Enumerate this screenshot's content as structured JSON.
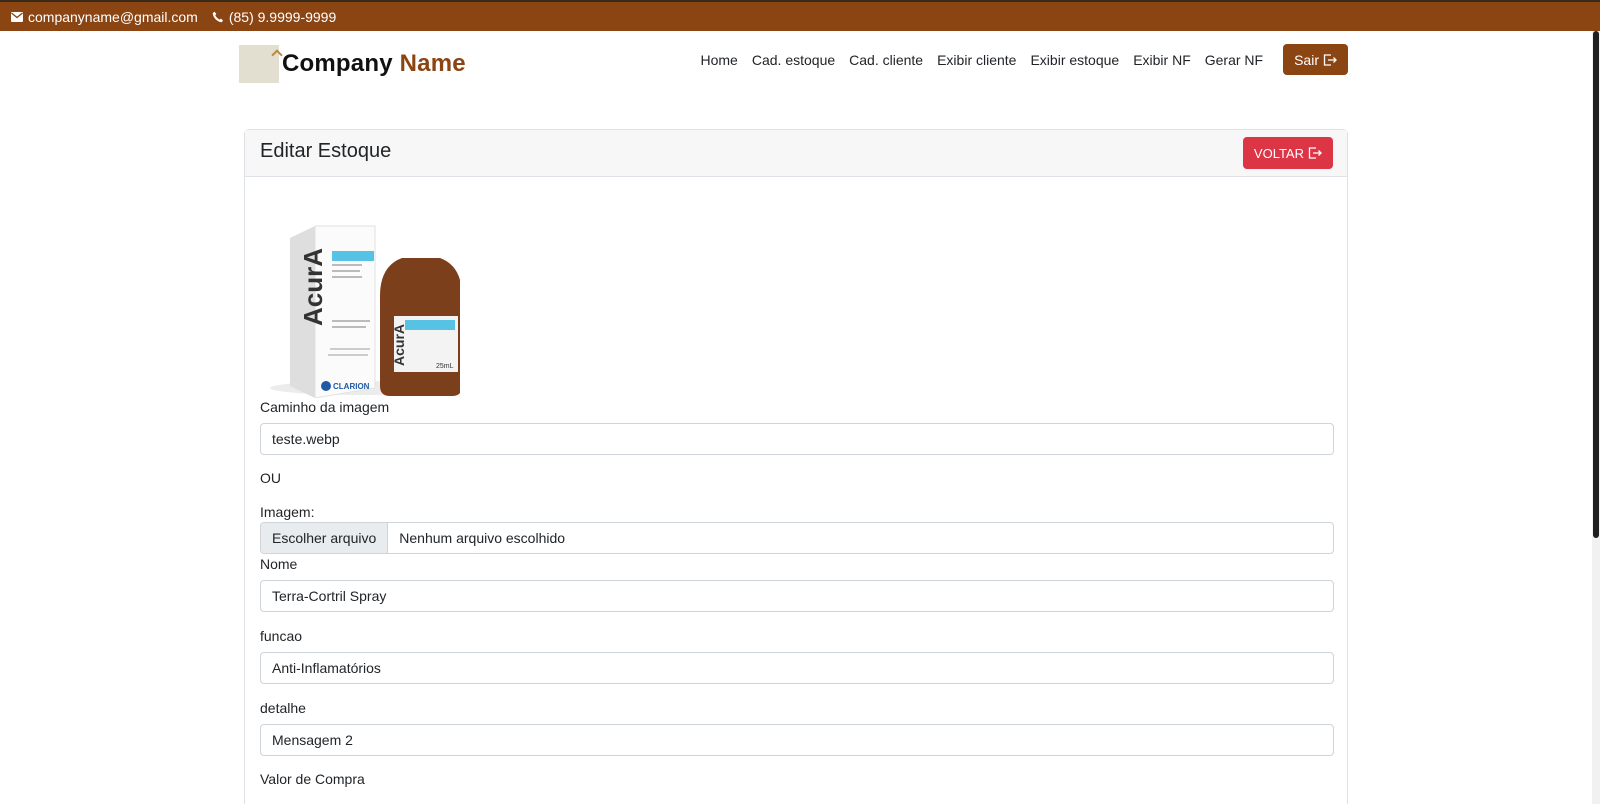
{
  "topbar": {
    "email": "companyname@gmail.com",
    "phone": "(85) 9.9999-9999",
    "bg_color": "#8b4513"
  },
  "brand": {
    "name_part1": "Company",
    "name_part2": "Name"
  },
  "nav": {
    "items": [
      "Home",
      "Cad. estoque",
      "Cad. cliente",
      "Exibir cliente",
      "Exibir estoque",
      "Exibir NF",
      "Gerar NF"
    ],
    "logout_label": "Sair"
  },
  "card": {
    "title": "Editar Estoque",
    "back_label": "VOLTAR",
    "back_color": "#dc3545"
  },
  "product_image": {
    "brand": "AcurA",
    "maker": "CLARION",
    "volume": "25mL"
  },
  "form": {
    "image_path_label": "Caminho da imagem",
    "image_path_value": "teste.webp",
    "or_label": "OU",
    "image_label": "Imagem:",
    "file_button": "Escolher arquivo",
    "file_status": "Nenhum arquivo escolhido",
    "name_label": "Nome",
    "name_value": "Terra-Cortril Spray",
    "function_label": "funcao",
    "function_value": "Anti-Inflamatórios",
    "detail_label": "detalhe",
    "detail_value": "Mensagem 2",
    "purchase_label": "Valor de Compra"
  }
}
